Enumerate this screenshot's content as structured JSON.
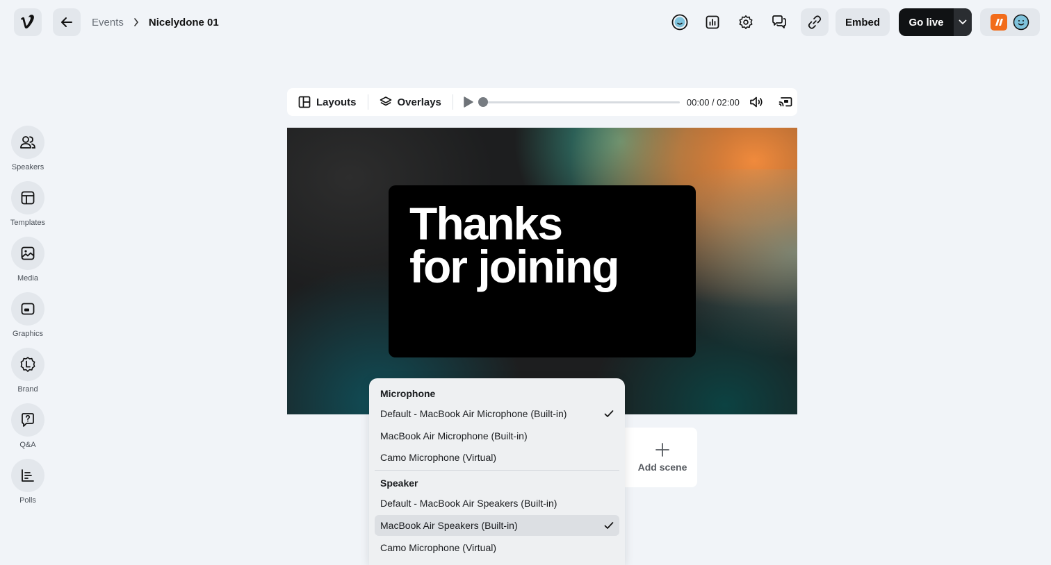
{
  "breadcrumb": {
    "parent": "Events",
    "current": "Nicelydone 01"
  },
  "header": {
    "embed_label": "Embed",
    "golive_label": "Go live"
  },
  "rail": [
    {
      "label": "Speakers",
      "icon": "users-icon"
    },
    {
      "label": "Templates",
      "icon": "layout-icon"
    },
    {
      "label": "Media",
      "icon": "image-icon"
    },
    {
      "label": "Graphics",
      "icon": "graphics-icon"
    },
    {
      "label": "Brand",
      "icon": "brand-icon"
    },
    {
      "label": "Q&A",
      "icon": "question-icon"
    },
    {
      "label": "Polls",
      "icon": "chart-icon"
    }
  ],
  "toolbar": {
    "layouts_label": "Layouts",
    "overlays_label": "Overlays",
    "time": "00:00 / 02:00",
    "progress": 0
  },
  "stage": {
    "line1": "Thanks",
    "line2": "for joining"
  },
  "add_scene_label": "Add scene",
  "menu": {
    "microphone_header": "Microphone",
    "microphone_items": [
      {
        "label": "Default - MacBook Air Microphone (Built-in)",
        "checked": true
      },
      {
        "label": "MacBook Air Microphone (Built-in)",
        "checked": false
      },
      {
        "label": "Camo Microphone (Virtual)",
        "checked": false
      }
    ],
    "speaker_header": "Speaker",
    "speaker_items": [
      {
        "label": "Default - MacBook Air Speakers (Built-in)",
        "checked": false
      },
      {
        "label": "MacBook Air Speakers (Built-in)",
        "checked": true
      },
      {
        "label": "Camo Microphone (Virtual)",
        "checked": false
      }
    ]
  },
  "colors": {
    "background": "#f1f4f8",
    "dark": "#101214",
    "brand_orange": "#f26c1a"
  }
}
